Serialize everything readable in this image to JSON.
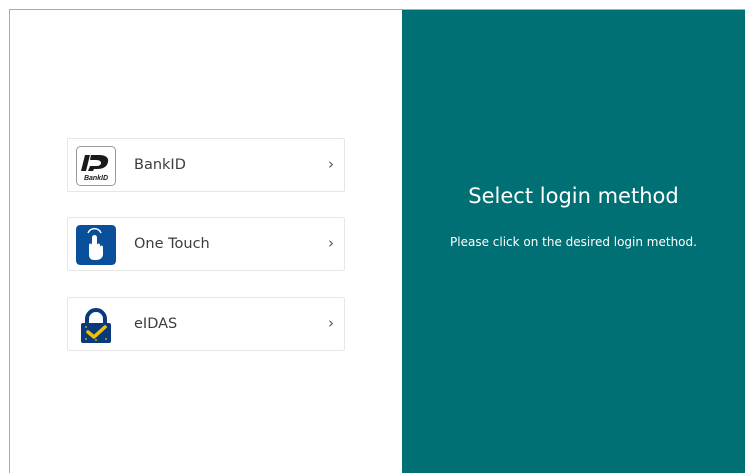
{
  "methods": [
    {
      "label": "BankID",
      "logo_text": "BankID",
      "chevron": "›"
    },
    {
      "label": "One Touch",
      "chevron": "›"
    },
    {
      "label": "eIDAS",
      "chevron": "›"
    }
  ],
  "panel": {
    "title": "Select login method",
    "subtitle": "Please click on the desired login method."
  },
  "colors": {
    "panel_bg": "#007075",
    "one_touch_bg": "#0a4f9c",
    "eidas_bg": "#0b3a7c",
    "eidas_check": "#f2c200"
  },
  "icons": {
    "bankid": "bankid-logo-icon",
    "one_touch": "hand-touch-icon",
    "eidas": "padlock-check-icon",
    "chevron": "chevron-right-icon"
  }
}
